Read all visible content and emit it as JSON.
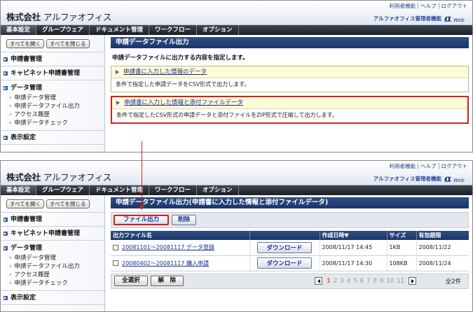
{
  "header": {
    "company": "株式会社",
    "company_sub": "アルファオフィス",
    "util_links": [
      "利用者機能",
      "ヘルプ",
      "ログアウト"
    ],
    "admin_label": "アルファオフィス管理者機能",
    "logo_text": "Web"
  },
  "nav": [
    "基本設定",
    "グループウェア",
    "ドキュメント管理",
    "ワークフロー",
    "オプション"
  ],
  "sidebar": {
    "open_all": "すべてを開く",
    "close_all": "すべてを閉じる",
    "sections": [
      "申請書管理",
      "キャビネット申請書管理"
    ],
    "data_mgmt": "データ管理",
    "data_items": [
      "申請データ管理",
      "申請データファイル出力",
      "アクセス履歴",
      "申請データチェック"
    ],
    "display_settings": "表示設定"
  },
  "screen1": {
    "title": "申請データファイル出力",
    "desc": "申請データファイルに出力する内容を指定します。",
    "options": [
      {
        "link": "申請書に入力した情報のデータ",
        "body": "条件で指定した申請データをCSV形式で出力します。"
      },
      {
        "link": "申請書に入力した情報と添付ファイルデータ",
        "body": "条件で指定したCSV形式の申請データと添付ファイルをZIP形式で圧縮して出力します。"
      }
    ]
  },
  "screen2": {
    "title": "申請データファイル出力(申請書に入力した情報と添付ファイルデータ)",
    "btn_output": "ファイル出力",
    "btn_delete": "削除",
    "columns": [
      "出力ファイル名",
      "",
      "作成日時▼",
      "サイズ",
      "有効期限"
    ],
    "rows": [
      {
        "name": "20081101～20081117 データ登録",
        "download": "ダウンロード",
        "created": "2008/11/17 14:45",
        "size": "1KB",
        "expires": "2008/11/22"
      },
      {
        "name": "20080402～20081117 購入申請",
        "download": "ダウンロード",
        "created": "2008/11/17 14:30",
        "size": "108KB",
        "expires": "2008/11/24"
      }
    ],
    "select_all": "全選択",
    "deselect": "解　除",
    "pages": [
      "1",
      "2",
      "3",
      "4",
      "5",
      "6",
      "7",
      "8",
      "9",
      "10",
      "11"
    ],
    "total": "全2件"
  }
}
